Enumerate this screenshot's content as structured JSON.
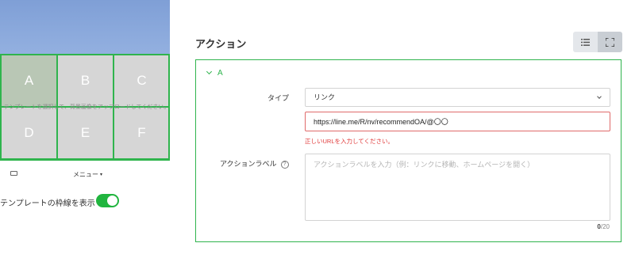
{
  "preview": {
    "cells": [
      "A",
      "B",
      "C",
      "D",
      "E",
      "F"
    ],
    "message": "テンプレートを選択して、背景画像をアップロードしてください。",
    "menu_label": "メニュー",
    "menu_caret": "▾",
    "keyboard_icon": "keyboard-icon"
  },
  "toggle": {
    "label": "テンプレートの枠線を表示",
    "on": true,
    "color": "#21b53f"
  },
  "section": {
    "title": "アクション"
  },
  "view_toggle": {
    "list_icon": "list-icon",
    "fullscreen_icon": "fullscreen-icon"
  },
  "action": {
    "header": "A",
    "type_label": "タイプ",
    "type_value": "リンク",
    "url_value": "https://line.me/R/nv/recommendOA/@〇〇",
    "error": "正しいURLを入力してください。",
    "action_label_label": "アクションラベル",
    "help_icon": "?",
    "action_label_placeholder": "アクションラベルを入力（例：リンクに移動、ホームページを開く）",
    "count_current": "0",
    "count_max": "/20"
  },
  "colors": {
    "accent": "#2fb44d",
    "error": "#e03a3a",
    "sky": "#8aa8dc"
  }
}
